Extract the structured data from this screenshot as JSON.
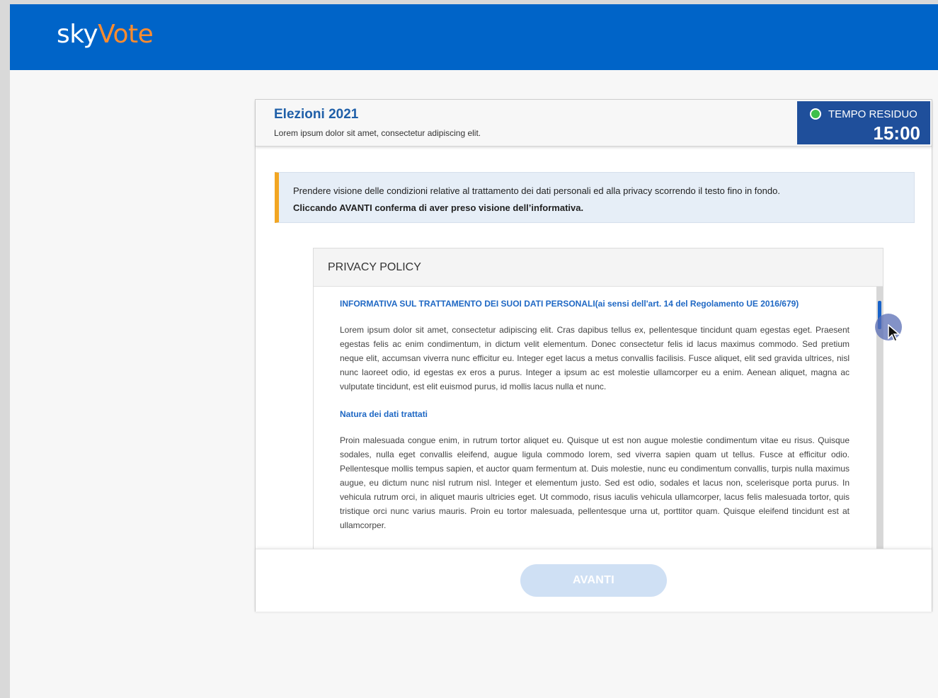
{
  "header": {
    "logo_part1": "sky",
    "logo_part2": "Vote"
  },
  "election": {
    "title": "Elezioni 2021",
    "subtitle": "Lorem ipsum dolor sit amet, consectetur adipiscing elit."
  },
  "timer": {
    "label": "TEMPO RESIDUO",
    "value": "15:00",
    "status_color": "#3fbf4a"
  },
  "notice": {
    "line1": "Prendere visione delle condizioni relative al trattamento dei dati personali ed alla privacy scorrendo il testo fino in fondo.",
    "line2": "Cliccando AVANTI conferma di aver preso visione dell’informativa."
  },
  "policy": {
    "title": "PRIVACY POLICY",
    "heading1": "INFORMATIVA SUL TRATTAMENTO DEI SUOI DATI PERSONALI(ai sensi dell'art. 14 del Regolamento UE 2016/679)",
    "paragraph1": "Lorem ipsum dolor sit amet, consectetur adipiscing elit. Cras dapibus tellus ex, pellentesque tincidunt quam egestas eget. Praesent egestas felis ac enim condimentum, in dictum velit elementum. Donec consectetur felis id lacus maximus commodo. Sed pretium neque elit, accumsan viverra nunc efficitur eu. Integer eget lacus a metus convallis facilisis. Fusce aliquet, elit sed gravida ultrices, nisl nunc laoreet odio, id egestas ex eros a purus. Integer a ipsum ac est molestie ullamcorper eu a enim. Aenean aliquet, magna ac vulputate tincidunt, est elit euismod purus, id mollis lacus nulla et nunc.",
    "heading2": "Natura dei dati trattati",
    "paragraph2": "Proin malesuada congue enim, in rutrum tortor aliquet eu. Quisque ut est non augue molestie condimentum vitae eu risus. Quisque sodales, nulla eget convallis eleifend, augue ligula commodo lorem, sed viverra sapien quam ut tellus. Fusce at efficitur odio. Pellentesque mollis tempus sapien, et auctor quam fermentum at. Duis molestie, nunc eu condimentum convallis, turpis nulla maximus augue, eu dictum nunc nisl rutrum nisl. Integer et elementum justo. Sed est odio, sodales et lacus non, scelerisque porta purus. In vehicula rutrum orci, in aliquet mauris ultricies eget. Ut commodo, risus iaculis vehicula ullamcorper, lacus felis malesuada tortor, quis tristique orci nunc varius mauris. Proin eu tortor malesuada, pellentesque urna ut, porttitor quam. Quisque eleifend tincidunt est at ullamcorper."
  },
  "footer": {
    "next_label": "AVANTI"
  },
  "colors": {
    "brand_blue": "#0064c8",
    "logo_accent": "#ff8c2e",
    "timer_bg": "#1f4f9b",
    "notice_accent": "#f2a623",
    "button_disabled": "#cfe0f4"
  }
}
